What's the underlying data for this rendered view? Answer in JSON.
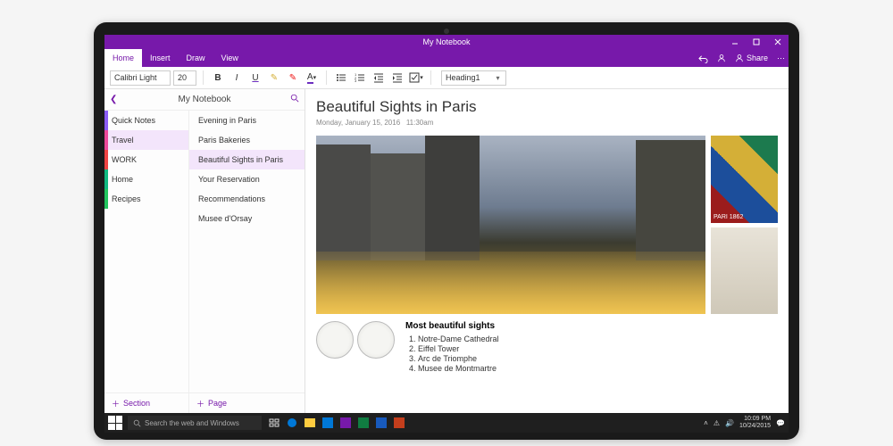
{
  "window": {
    "title": "My Notebook"
  },
  "ribbon": {
    "tabs": [
      "Home",
      "Insert",
      "Draw",
      "View"
    ],
    "active": "Home",
    "undo": "Undo",
    "account": "Account",
    "share": "Share"
  },
  "toolbar": {
    "font_name": "Calibri Light",
    "font_size": "20",
    "style_select": "Heading1"
  },
  "nav": {
    "notebook_title": "My Notebook",
    "sections": [
      {
        "label": "Quick Notes",
        "color": 0
      },
      {
        "label": "Travel",
        "color": 1,
        "selected": true
      },
      {
        "label": "WORK",
        "color": 2
      },
      {
        "label": "Home",
        "color": 3
      },
      {
        "label": "Recipes",
        "color": 4
      }
    ],
    "pages": [
      {
        "label": "Evening in Paris"
      },
      {
        "label": "Paris Bakeries"
      },
      {
        "label": "Beautiful Sights in Paris",
        "selected": true
      },
      {
        "label": "Your Reservation"
      },
      {
        "label": "Recommendations"
      },
      {
        "label": "Musee d'Orsay"
      }
    ],
    "add_section": "Section",
    "add_page": "Page"
  },
  "page": {
    "title": "Beautiful Sights in Paris",
    "date": "Monday, January 15, 2016",
    "time": "11:30am",
    "thumb_label": "PARI\n1862",
    "sights_heading": "Most beautiful sights",
    "sights": [
      "Notre-Dame Cathedral",
      "Eiffel Tower",
      "Arc de Triomphe",
      "Musee de Montmartre"
    ]
  },
  "taskbar": {
    "search_placeholder": "Search the web and Windows",
    "time": "10:09 PM",
    "date": "10/24/2015"
  }
}
